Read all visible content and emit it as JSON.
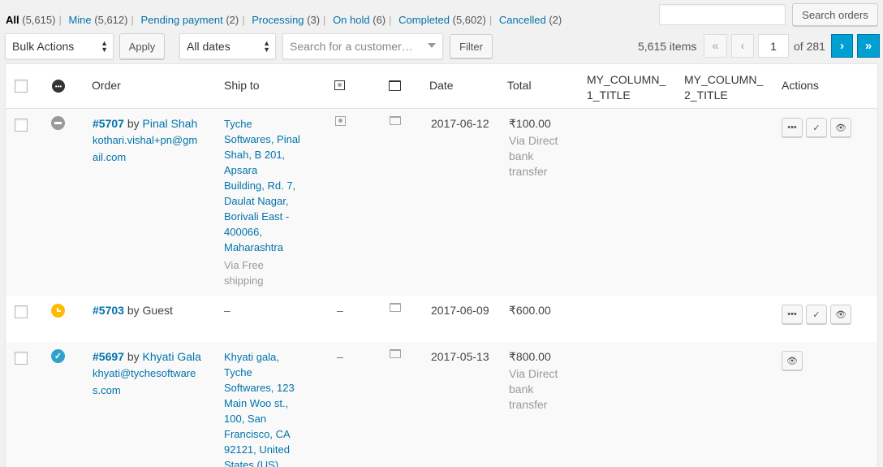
{
  "status_links": [
    {
      "label": "All",
      "count": "(5,615)",
      "current": true
    },
    {
      "label": "Mine",
      "count": "(5,612)"
    },
    {
      "label": "Pending payment",
      "count": "(2)"
    },
    {
      "label": "Processing",
      "count": "(3)"
    },
    {
      "label": "On hold",
      "count": "(6)"
    },
    {
      "label": "Completed",
      "count": "(5,602)"
    },
    {
      "label": "Cancelled",
      "count": "(2)"
    }
  ],
  "search": {
    "value": "",
    "button": "Search orders"
  },
  "tablenav": {
    "bulk_actions": "Bulk Actions",
    "apply": "Apply",
    "dates": "All dates",
    "customer_placeholder": "Search for a customer…",
    "filter": "Filter",
    "items": "5,615 items",
    "first": "«",
    "prev": "‹",
    "current_page": "1",
    "of_pages": "of 281",
    "next": "›",
    "last": "»"
  },
  "columns": {
    "order": "Order",
    "ship_to": "Ship to",
    "date": "Date",
    "total": "Total",
    "my_col_1": [
      "MY_COLUMN_",
      "1_TITLE"
    ],
    "my_col_2": [
      "MY_COLUMN_",
      "2_TITLE"
    ],
    "actions": "Actions"
  },
  "orders": [
    {
      "number": "#5707",
      "by": "by",
      "customer": "Pinal Shah",
      "email_lines": [
        "kothari.vishal+pn@gm",
        "ail.com"
      ],
      "status": "cancelled",
      "status_color": "#999999",
      "ship_lines": [
        "Tyche",
        "Softwares, Pinal",
        "Shah, B 201,",
        "Apsara",
        "Building, Rd. 7,",
        "Daulat Nagar,",
        "Borivali East -",
        "400066,",
        "Maharashtra"
      ],
      "ship_method": [
        "Via Free",
        "shipping"
      ],
      "date": "2017-06-12",
      "total": "₹100.00",
      "pay_method": [
        "Via Direct",
        "bank",
        "transfer"
      ],
      "actions": [
        "•••",
        "✓",
        "👁"
      ]
    },
    {
      "number": "#5703",
      "by": "by",
      "customer": "Guest",
      "status": "on-hold",
      "status_color": "#ffba00",
      "ship_dash": "–",
      "dash": "–",
      "date": "2017-06-09",
      "total": "₹600.00",
      "actions": [
        "•••",
        "✓",
        "👁"
      ]
    },
    {
      "number": "#5697",
      "by": "by",
      "customer": "Khyati Gala",
      "email_lines": [
        "khyati@tychesoftware",
        "s.com"
      ],
      "status": "completed",
      "status_color": "#2ea2cc",
      "ship_lines": [
        "Khyati gala,",
        "Tyche",
        "Softwares, 123",
        "Main Woo st.,",
        "100, San",
        "Francisco, CA",
        "92121, United",
        "States (US)"
      ],
      "dash": "–",
      "date": "2017-05-13",
      "total": "₹800.00",
      "pay_method": [
        "Via Direct",
        "bank",
        "transfer"
      ],
      "actions": [
        "👁"
      ]
    }
  ]
}
